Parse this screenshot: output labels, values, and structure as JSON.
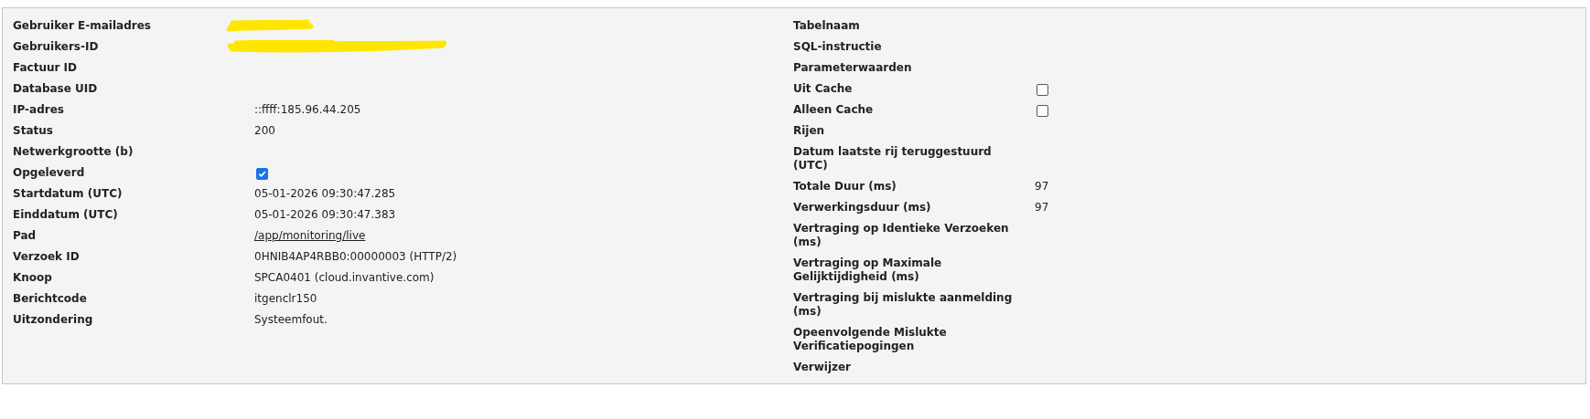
{
  "left_fields": [
    {
      "label": "Gebruiker E-mailadres",
      "kind": "redacted"
    },
    {
      "label": "Gebruikers-ID",
      "kind": "redacted"
    },
    {
      "label": "Factuur ID",
      "kind": "text"
    },
    {
      "label": "Database UID",
      "kind": "text"
    },
    {
      "label": "IP-adres",
      "kind": "text",
      "value": "::ffff:185.96.44.205"
    },
    {
      "label": "Status",
      "kind": "text",
      "value": "200"
    },
    {
      "label": "Netwerkgrootte (b)",
      "kind": "text"
    },
    {
      "label": "Opgeleverd",
      "kind": "checkbox",
      "checked": true
    },
    {
      "label": "Startdatum (UTC)",
      "kind": "text",
      "value": "05-01-2026 09:30:47.285"
    },
    {
      "label": "Einddatum (UTC)",
      "kind": "text",
      "value": "05-01-2026 09:30:47.383"
    },
    {
      "label": "Pad",
      "kind": "link",
      "value": "/app/monitoring/live"
    },
    {
      "label": "Verzoek ID",
      "kind": "text",
      "value": "0HNIB4AP4RBB0:00000003 (HTTP/2)"
    },
    {
      "label": "Knoop",
      "kind": "text",
      "value": "SPCA0401 (cloud.invantive.com)"
    },
    {
      "label": "Berichtcode",
      "kind": "text",
      "value": "itgenclr150"
    },
    {
      "label": "Uitzondering",
      "kind": "text",
      "value": "Systeemfout."
    }
  ],
  "right_fields": [
    {
      "label": "Tabelnaam",
      "kind": "text"
    },
    {
      "label": "SQL-instructie",
      "kind": "text"
    },
    {
      "label": "Parameterwaarden",
      "kind": "text"
    },
    {
      "label": "Uit Cache",
      "kind": "checkbox",
      "checked": false
    },
    {
      "label": "Alleen Cache",
      "kind": "checkbox",
      "checked": false
    },
    {
      "label": "Rijen",
      "kind": "text"
    },
    {
      "label": "Datum laatste rij teruggestuurd (UTC)",
      "kind": "text"
    },
    {
      "label": "Totale Duur (ms)",
      "kind": "text",
      "value": "97"
    },
    {
      "label": "Verwerkingsduur (ms)",
      "kind": "text",
      "value": "97"
    },
    {
      "label": "Vertraging op Identieke Verzoeken (ms)",
      "kind": "text"
    },
    {
      "label": "Vertraging op Maximale Gelijktijdigheid (ms)",
      "kind": "text"
    },
    {
      "label": "Vertraging bij mislukte aanmelding (ms)",
      "kind": "text"
    },
    {
      "label": "Opeenvolgende Mislukte Verificatiepogingen",
      "kind": "text"
    },
    {
      "label": "Verwijzer",
      "kind": "text"
    }
  ]
}
